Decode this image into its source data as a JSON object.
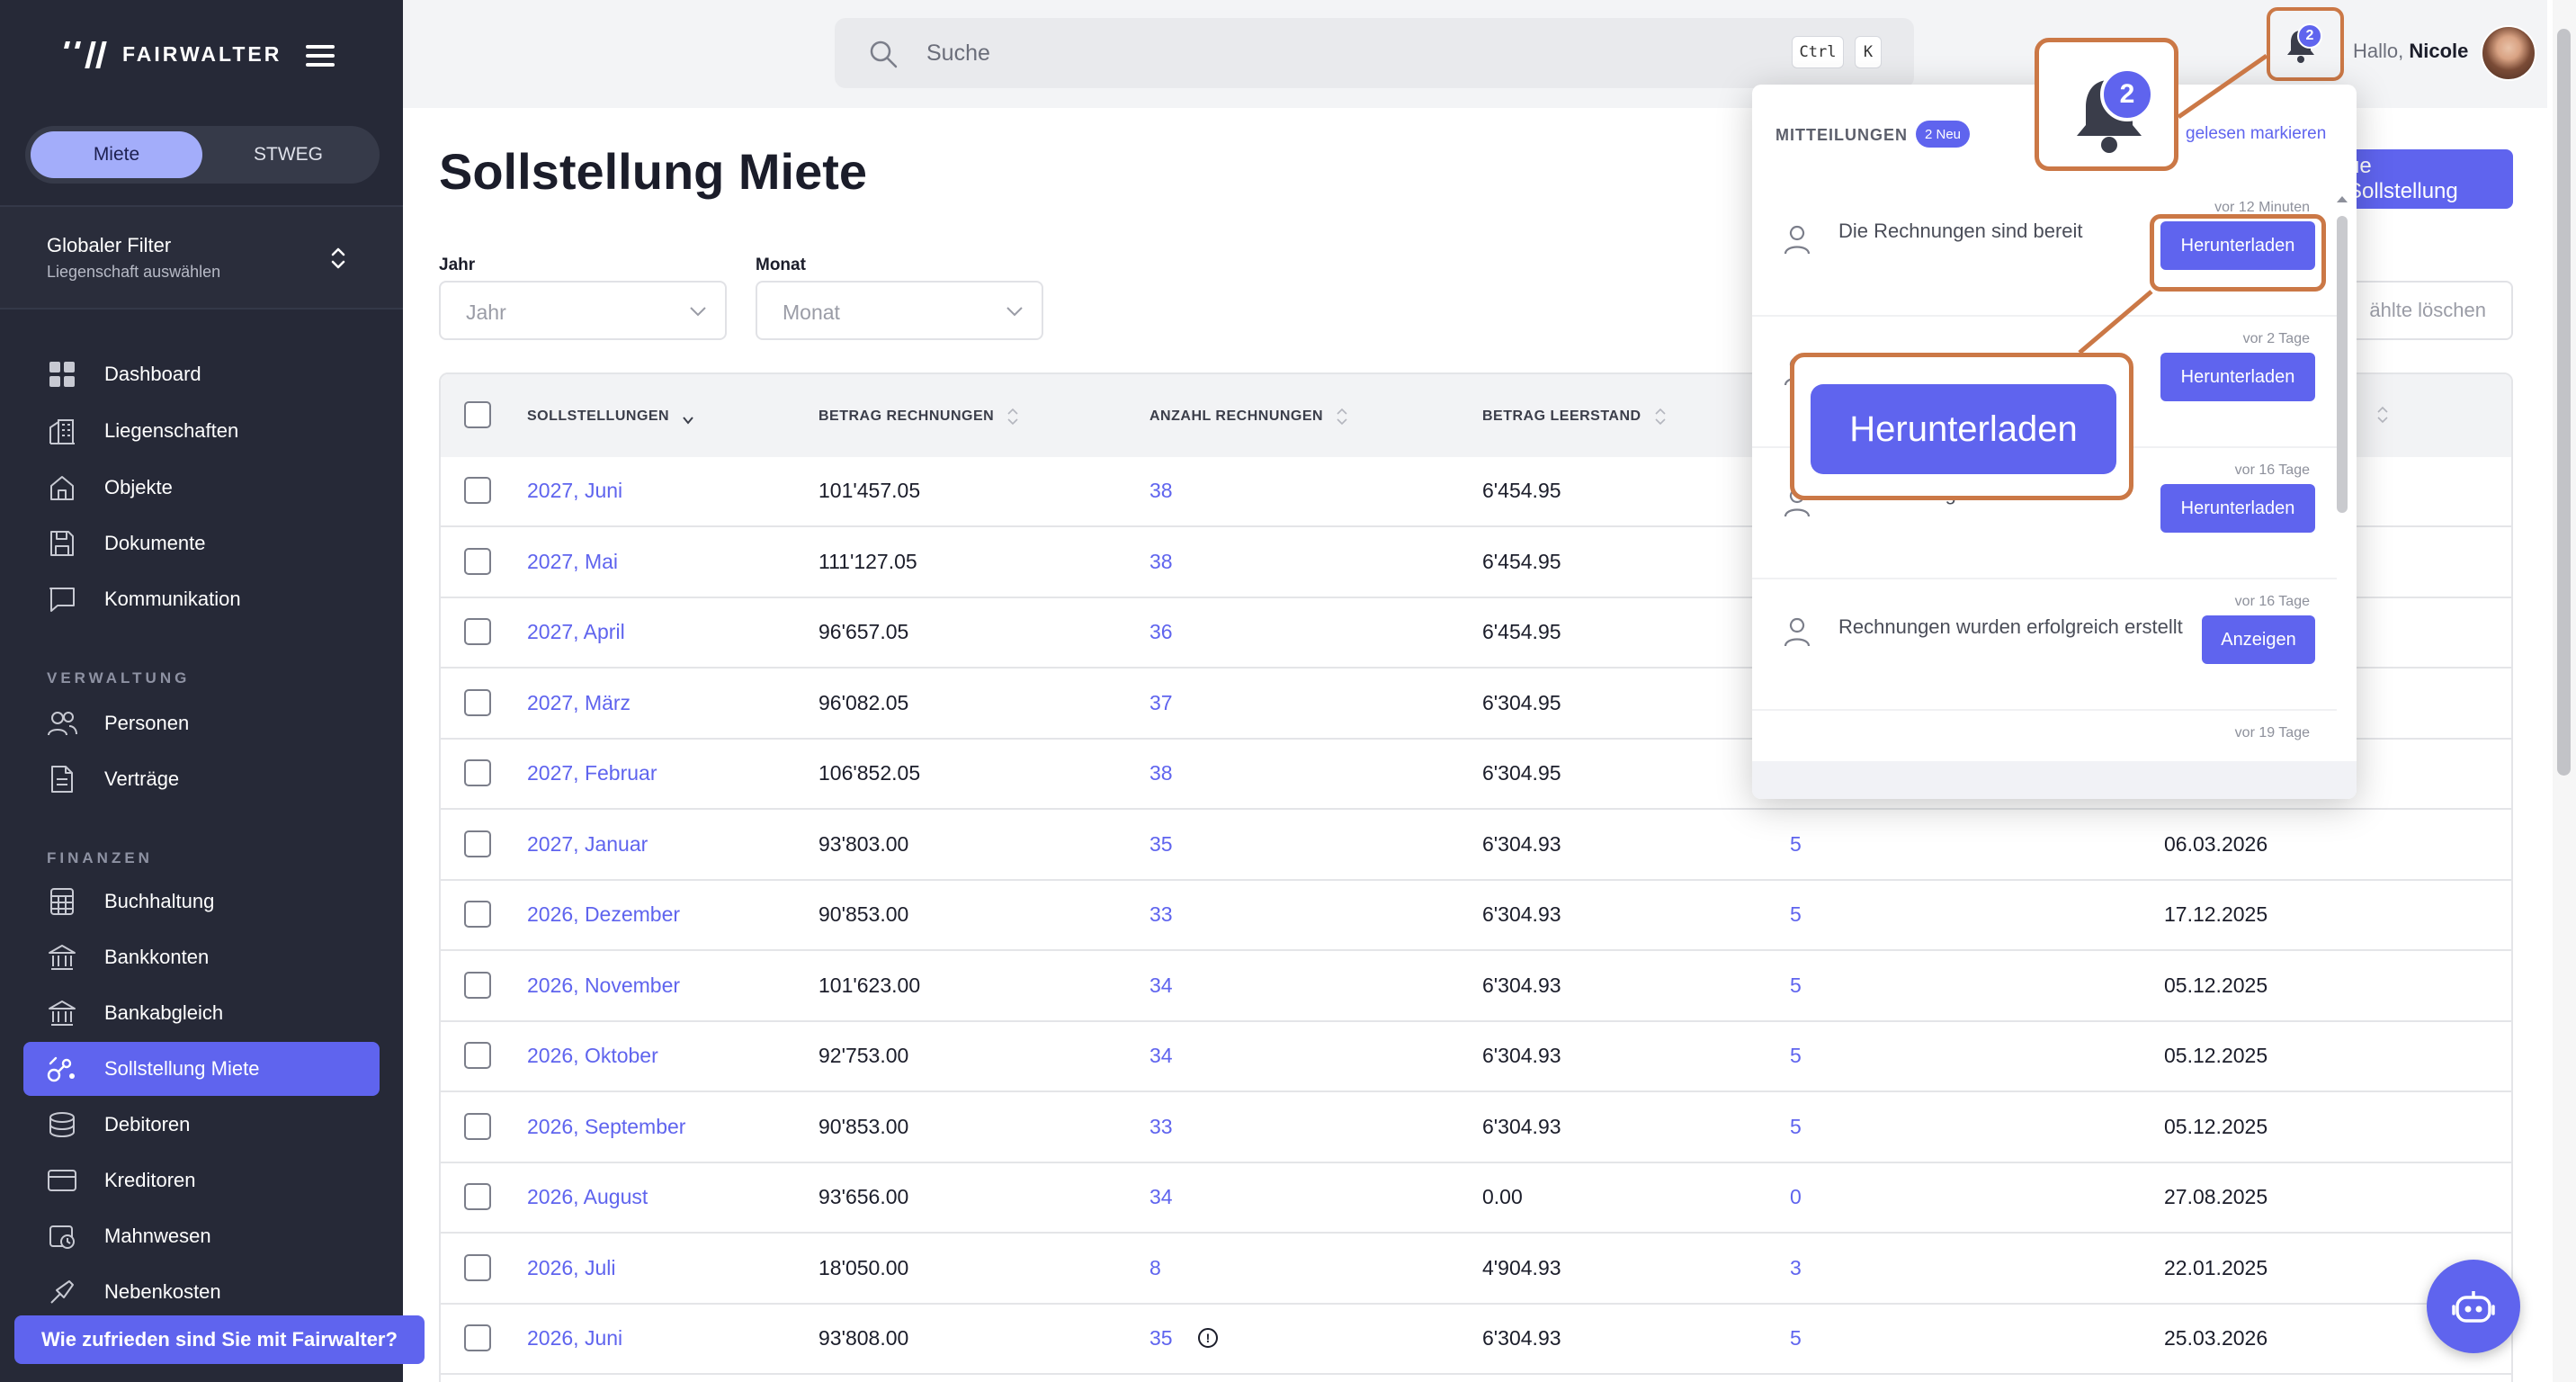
{
  "brand": {
    "name": "FAIRWALTER"
  },
  "sidebar": {
    "toggle": [
      "Miete",
      "STWEG"
    ],
    "filter": {
      "title": "Globaler Filter",
      "subtitle": "Liegenschaft auswählen"
    },
    "main": [
      {
        "label": "Dashboard",
        "icon": "dashboard-icon"
      },
      {
        "label": "Liegenschaften",
        "icon": "buildings-icon"
      },
      {
        "label": "Objekte",
        "icon": "house-icon"
      },
      {
        "label": "Dokumente",
        "icon": "document-icon"
      },
      {
        "label": "Kommunikation",
        "icon": "chat-icon"
      }
    ],
    "section_verwaltung": "VERWALTUNG",
    "verwaltung": [
      {
        "label": "Personen",
        "icon": "people-icon"
      },
      {
        "label": "Verträge",
        "icon": "contract-icon"
      }
    ],
    "section_finanzen": "FINANZEN",
    "finanzen": [
      {
        "label": "Buchhaltung",
        "icon": "calculator-icon"
      },
      {
        "label": "Bankkonten",
        "icon": "bank-icon"
      },
      {
        "label": "Bankabgleich",
        "icon": "bank-icon"
      },
      {
        "label": "Sollstellung Miete",
        "icon": "rent-icon"
      },
      {
        "label": "Debitoren",
        "icon": "coins-icon"
      },
      {
        "label": "Kreditoren",
        "icon": "card-icon"
      },
      {
        "label": "Mahnwesen",
        "icon": "reminder-icon"
      },
      {
        "label": "Nebenkosten",
        "icon": "utilities-icon"
      }
    ],
    "survey": "Wie zufrieden sind Sie mit Fairwalter?"
  },
  "topbar": {
    "search_placeholder": "Suche",
    "kbd": [
      "Ctrl",
      "K"
    ],
    "bell_count": "2",
    "greeting": "Hallo,",
    "user": "Nicole"
  },
  "page": {
    "title": "Sollstellung Miete",
    "new_button": "Neue Sollstellung",
    "new_button_visible": "ue Sollstellung",
    "clear_button_visible": "ählte löschen",
    "filters": [
      {
        "label": "Jahr",
        "placeholder": "Jahr"
      },
      {
        "label": "Monat",
        "placeholder": "Monat"
      }
    ]
  },
  "table": {
    "columns": [
      "SOLLSTELLUNGEN",
      "BETRAG RECHNUNGEN",
      "ANZAHL RECHNUNGEN",
      "BETRAG LEERSTAND"
    ],
    "rows": [
      {
        "period": "2027, Juni",
        "amount": "101'457.05",
        "count": "38",
        "vacancy": "6'454.95",
        "n": "",
        "date": ""
      },
      {
        "period": "2027, Mai",
        "amount": "111'127.05",
        "count": "38",
        "vacancy": "6'454.95",
        "n": "",
        "date": ""
      },
      {
        "period": "2027, April",
        "amount": "96'657.05",
        "count": "36",
        "vacancy": "6'454.95",
        "n": "",
        "date": ""
      },
      {
        "period": "2027, März",
        "amount": "96'082.05",
        "count": "37",
        "vacancy": "6'304.95",
        "n": "",
        "date": ""
      },
      {
        "period": "2027, Februar",
        "amount": "106'852.05",
        "count": "38",
        "vacancy": "6'304.95",
        "n": "",
        "date": ""
      },
      {
        "period": "2027, Januar",
        "amount": "93'803.00",
        "count": "35",
        "vacancy": "6'304.93",
        "n": "5",
        "date": "06.03.2026"
      },
      {
        "period": "2026, Dezember",
        "amount": "90'853.00",
        "count": "33",
        "vacancy": "6'304.93",
        "n": "5",
        "date": "17.12.2025"
      },
      {
        "period": "2026, November",
        "amount": "101'623.00",
        "count": "34",
        "vacancy": "6'304.93",
        "n": "5",
        "date": "05.12.2025"
      },
      {
        "period": "2026, Oktober",
        "amount": "92'753.00",
        "count": "34",
        "vacancy": "6'304.93",
        "n": "5",
        "date": "05.12.2025"
      },
      {
        "period": "2026, September",
        "amount": "90'853.00",
        "count": "33",
        "vacancy": "6'304.93",
        "n": "5",
        "date": "05.12.2025"
      },
      {
        "period": "2026, August",
        "amount": "93'656.00",
        "count": "34",
        "vacancy": "0.00",
        "n": "0",
        "date": "27.08.2025"
      },
      {
        "period": "2026, Juli",
        "amount": "18'050.00",
        "count": "8",
        "vacancy": "4'904.93",
        "n": "3",
        "date": "22.01.2025"
      },
      {
        "period": "2026, Juni",
        "amount": "93'808.00",
        "count": "35",
        "vacancy": "6'304.93",
        "n": "5",
        "date": "25.03.2026"
      }
    ]
  },
  "notifications": {
    "title": "MITTEILUNGEN",
    "new_badge": "2 Neu",
    "mark_read": "gelesen markieren",
    "items": [
      {
        "time": "vor 12 Minuten",
        "text": "Die Rechnungen sind bereit",
        "button": "Herunterladen"
      },
      {
        "time": "vor 2 Tage",
        "text": "",
        "button": "Herunterladen"
      },
      {
        "time": "vor 16 Tage",
        "text": "Die Mahnungen sind bereit",
        "button": "Herunterladen"
      },
      {
        "time": "vor 16 Tage",
        "text": "Rechnungen wurden erfolgreich erstellt",
        "button": "Anzeigen"
      },
      {
        "time": "vor 19 Tage",
        "text": "",
        "button": ""
      }
    ]
  },
  "callouts": {
    "bell_count": "2",
    "button": "Herunterladen"
  },
  "colors": {
    "accent": "#5f64ee",
    "sidebar": "#262937",
    "highlight": "#cb7846"
  }
}
